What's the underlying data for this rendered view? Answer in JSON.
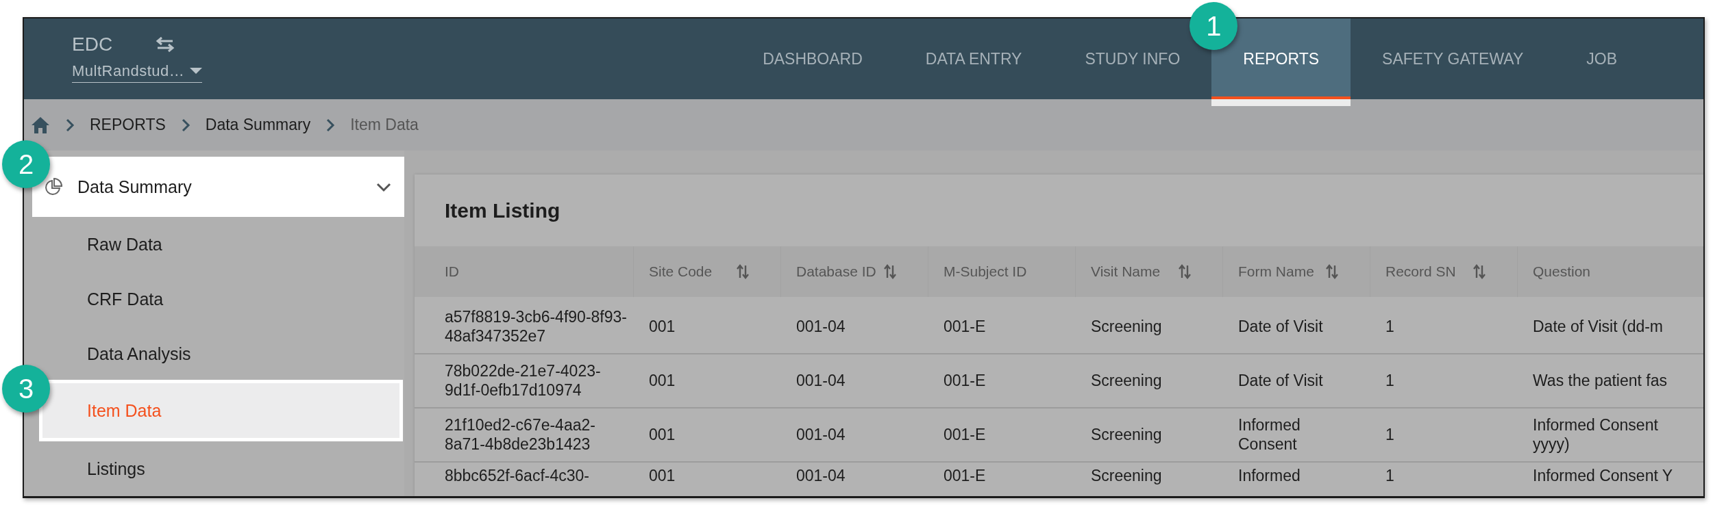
{
  "header": {
    "app_name": "EDC",
    "study_selector": "MultRandstud…",
    "nav": [
      {
        "label": "DASHBOARD",
        "selected": false
      },
      {
        "label": "DATA ENTRY",
        "selected": false
      },
      {
        "label": "STUDY INFO",
        "selected": false
      },
      {
        "label": "REPORTS",
        "selected": true,
        "callout": "1"
      },
      {
        "label": "SAFETY GATEWAY",
        "selected": false
      },
      {
        "label": "JOB",
        "selected": false
      }
    ]
  },
  "breadcrumb": [
    "REPORTS",
    "Data Summary",
    "Item Data"
  ],
  "sidebar": {
    "section": {
      "label": "Data Summary",
      "expanded": true,
      "callout": "2"
    },
    "items": [
      {
        "label": "Raw Data",
        "selected": false
      },
      {
        "label": "CRF Data",
        "selected": false
      },
      {
        "label": "Data Analysis",
        "selected": false
      },
      {
        "label": "Item Data",
        "selected": true,
        "callout": "3"
      },
      {
        "label": "Listings",
        "selected": false
      }
    ]
  },
  "card": {
    "title": "Item Listing"
  },
  "table": {
    "columns": [
      {
        "label": "ID",
        "sortable": false
      },
      {
        "label": "Site Code",
        "sortable": true
      },
      {
        "label": "Database ID",
        "sortable": true
      },
      {
        "label": "M-Subject ID",
        "sortable": false
      },
      {
        "label": "Visit Name",
        "sortable": true
      },
      {
        "label": "Form Name",
        "sortable": true
      },
      {
        "label": "Record SN",
        "sortable": true
      },
      {
        "label": "Question",
        "sortable": false
      }
    ],
    "rows": [
      [
        "a57f8819-3cb6-4f90-8f93-48af347352e7",
        "001",
        "001-04",
        "001-E",
        "Screening",
        "Date of Visit",
        "1",
        "Date of Visit (dd-m"
      ],
      [
        "78b022de-21e7-4023-9d1f-0efb17d10974",
        "001",
        "001-04",
        "001-E",
        "Screening",
        "Date of Visit",
        "1",
        "Was the patient fas"
      ],
      [
        "21f10ed2-c67e-4aa2-8a71-4b8de23b1423",
        "001",
        "001-04",
        "001-E",
        "Screening",
        "Informed Consent",
        "1",
        "Informed Consent yyyy)"
      ],
      [
        "8bbc652f-6acf-4c30-",
        "001",
        "001-04",
        "001-E",
        "Screening",
        "Informed",
        "1",
        "Informed Consent Y"
      ]
    ]
  }
}
